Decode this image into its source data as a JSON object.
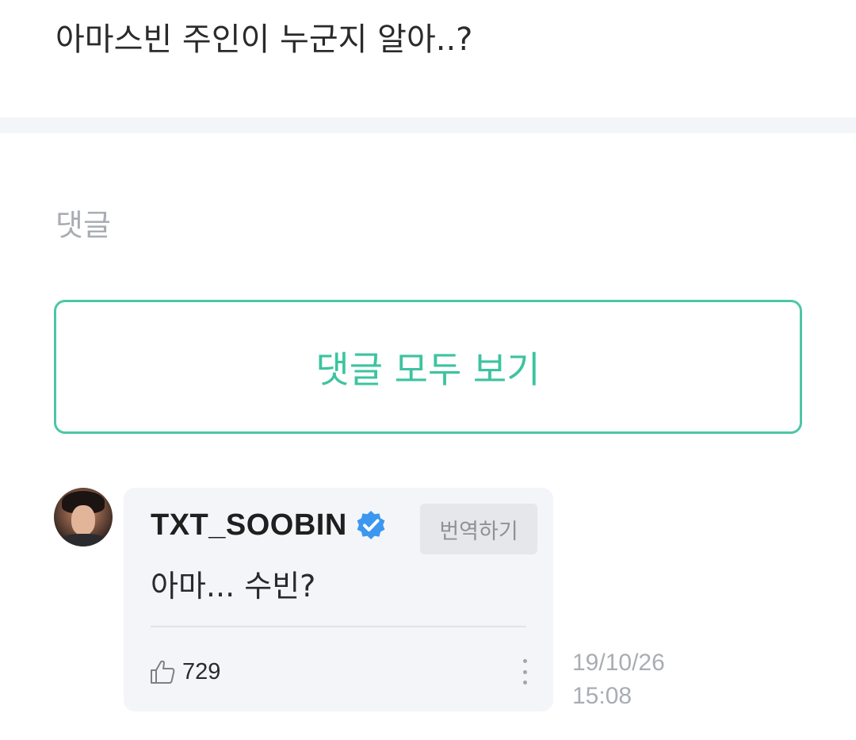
{
  "post": {
    "text": "아마스빈 주인이 누군지 알아..?"
  },
  "comments_section": {
    "heading": "댓글",
    "view_all_label": "댓글 모두 보기",
    "accent_color": "#3cc3a0"
  },
  "comment": {
    "author": "TXT_SOOBIN",
    "verified": true,
    "translate_label": "번역하기",
    "body": "아마... 수빈?",
    "likes": "729",
    "date": "19/10/26",
    "time": "15:08",
    "icons": [
      "avatar",
      "verified-badge-icon",
      "thumbs-up-icon",
      "more-options-icon"
    ],
    "verified_color": "#3d97f0"
  }
}
